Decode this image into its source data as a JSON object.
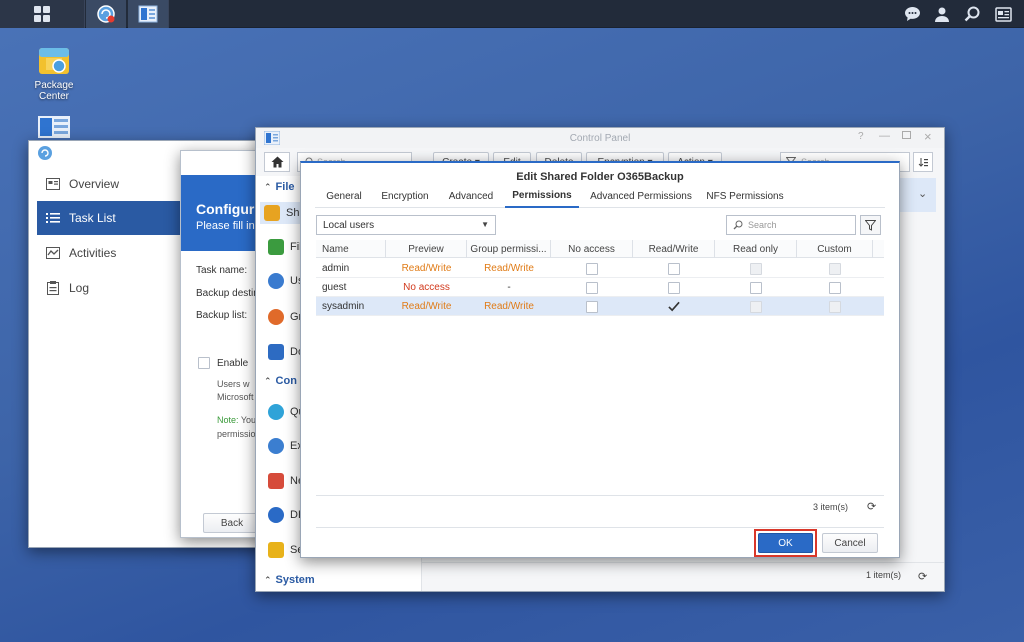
{
  "desktop": {
    "icons": [
      {
        "label_line1": "Package",
        "label_line2": "Center"
      }
    ]
  },
  "backup_window": {
    "sidebar": [
      {
        "label": "Overview",
        "icon": "overview-icon"
      },
      {
        "label": "Task List",
        "icon": "task-list-icon",
        "active": true
      },
      {
        "label": "Activities",
        "icon": "activities-icon"
      },
      {
        "label": "Log",
        "icon": "log-icon"
      }
    ],
    "wizard": {
      "title": "Configur",
      "subtitle": "Please fill in",
      "task_name_label": "Task name:",
      "backup_dest_label": "Backup destin",
      "backup_list_label": "Backup list:",
      "enable_label": "Enable",
      "users_line1": "Users w",
      "users_line2": "Microsoft",
      "note_label": "Note:",
      "note_text": " You",
      "note_line2": "permissio",
      "back_button": "Back"
    }
  },
  "control_panel": {
    "title": "Control Panel",
    "toolbar": {
      "search_placeholder": "Search",
      "create": "Create",
      "edit": "Edit",
      "delete": "Delete",
      "encryption": "Encryption",
      "action": "Action",
      "filter_placeholder": "Search"
    },
    "nav": {
      "file_section": "File",
      "items": [
        {
          "label": "Sh",
          "color": "#e7a321"
        },
        {
          "label": "Fil",
          "color": "#3b9b3f"
        },
        {
          "label": "Us",
          "color": "#3a7bcf"
        },
        {
          "label": "Gr",
          "color": "#e06a2a"
        },
        {
          "label": "Do",
          "color": "#2d6bc2"
        }
      ],
      "conn_section": "Con",
      "conn_items": [
        {
          "label": "Qu",
          "color": "#2fa3d8"
        },
        {
          "label": "Ex",
          "color": "#3b7ed0"
        },
        {
          "label": "Ne",
          "color": "#d64b3a"
        },
        {
          "label": "DH",
          "color": "#2a6ac6"
        },
        {
          "label": "Se",
          "color": "#e8b21a"
        }
      ],
      "system_section": "System"
    },
    "footer_count": "1 item(s)"
  },
  "dialog": {
    "title": "Edit Shared Folder O365Backup",
    "tabs": [
      "General",
      "Encryption",
      "Advanced",
      "Permissions",
      "Advanced Permissions",
      "NFS Permissions"
    ],
    "active_tab": "Permissions",
    "user_type": "Local users",
    "search_placeholder": "Search",
    "columns": [
      "Name",
      "Preview",
      "Group permissi...",
      "No access",
      "Read/Write",
      "Read only",
      "Custom"
    ],
    "rows": [
      {
        "name": "admin",
        "preview": "Read/Write",
        "group": "Read/Write",
        "no_access": false,
        "read_write": false,
        "read_only": false,
        "custom": false,
        "selected": false
      },
      {
        "name": "guest",
        "preview": "No access",
        "group": "-",
        "no_access": false,
        "read_write": false,
        "read_only": false,
        "custom": false,
        "selected": false
      },
      {
        "name": "sysadmin",
        "preview": "Read/Write",
        "group": "Read/Write",
        "no_access": false,
        "read_write": true,
        "read_only": false,
        "custom": false,
        "selected": true
      }
    ],
    "item_count": "3 item(s)",
    "ok_button": "OK",
    "cancel_button": "Cancel",
    "colors": {
      "accent": "#2a6ac6",
      "highlight": "#d9372a",
      "preview_orange": "#e07b16",
      "preview_red": "#d23a1d"
    }
  }
}
